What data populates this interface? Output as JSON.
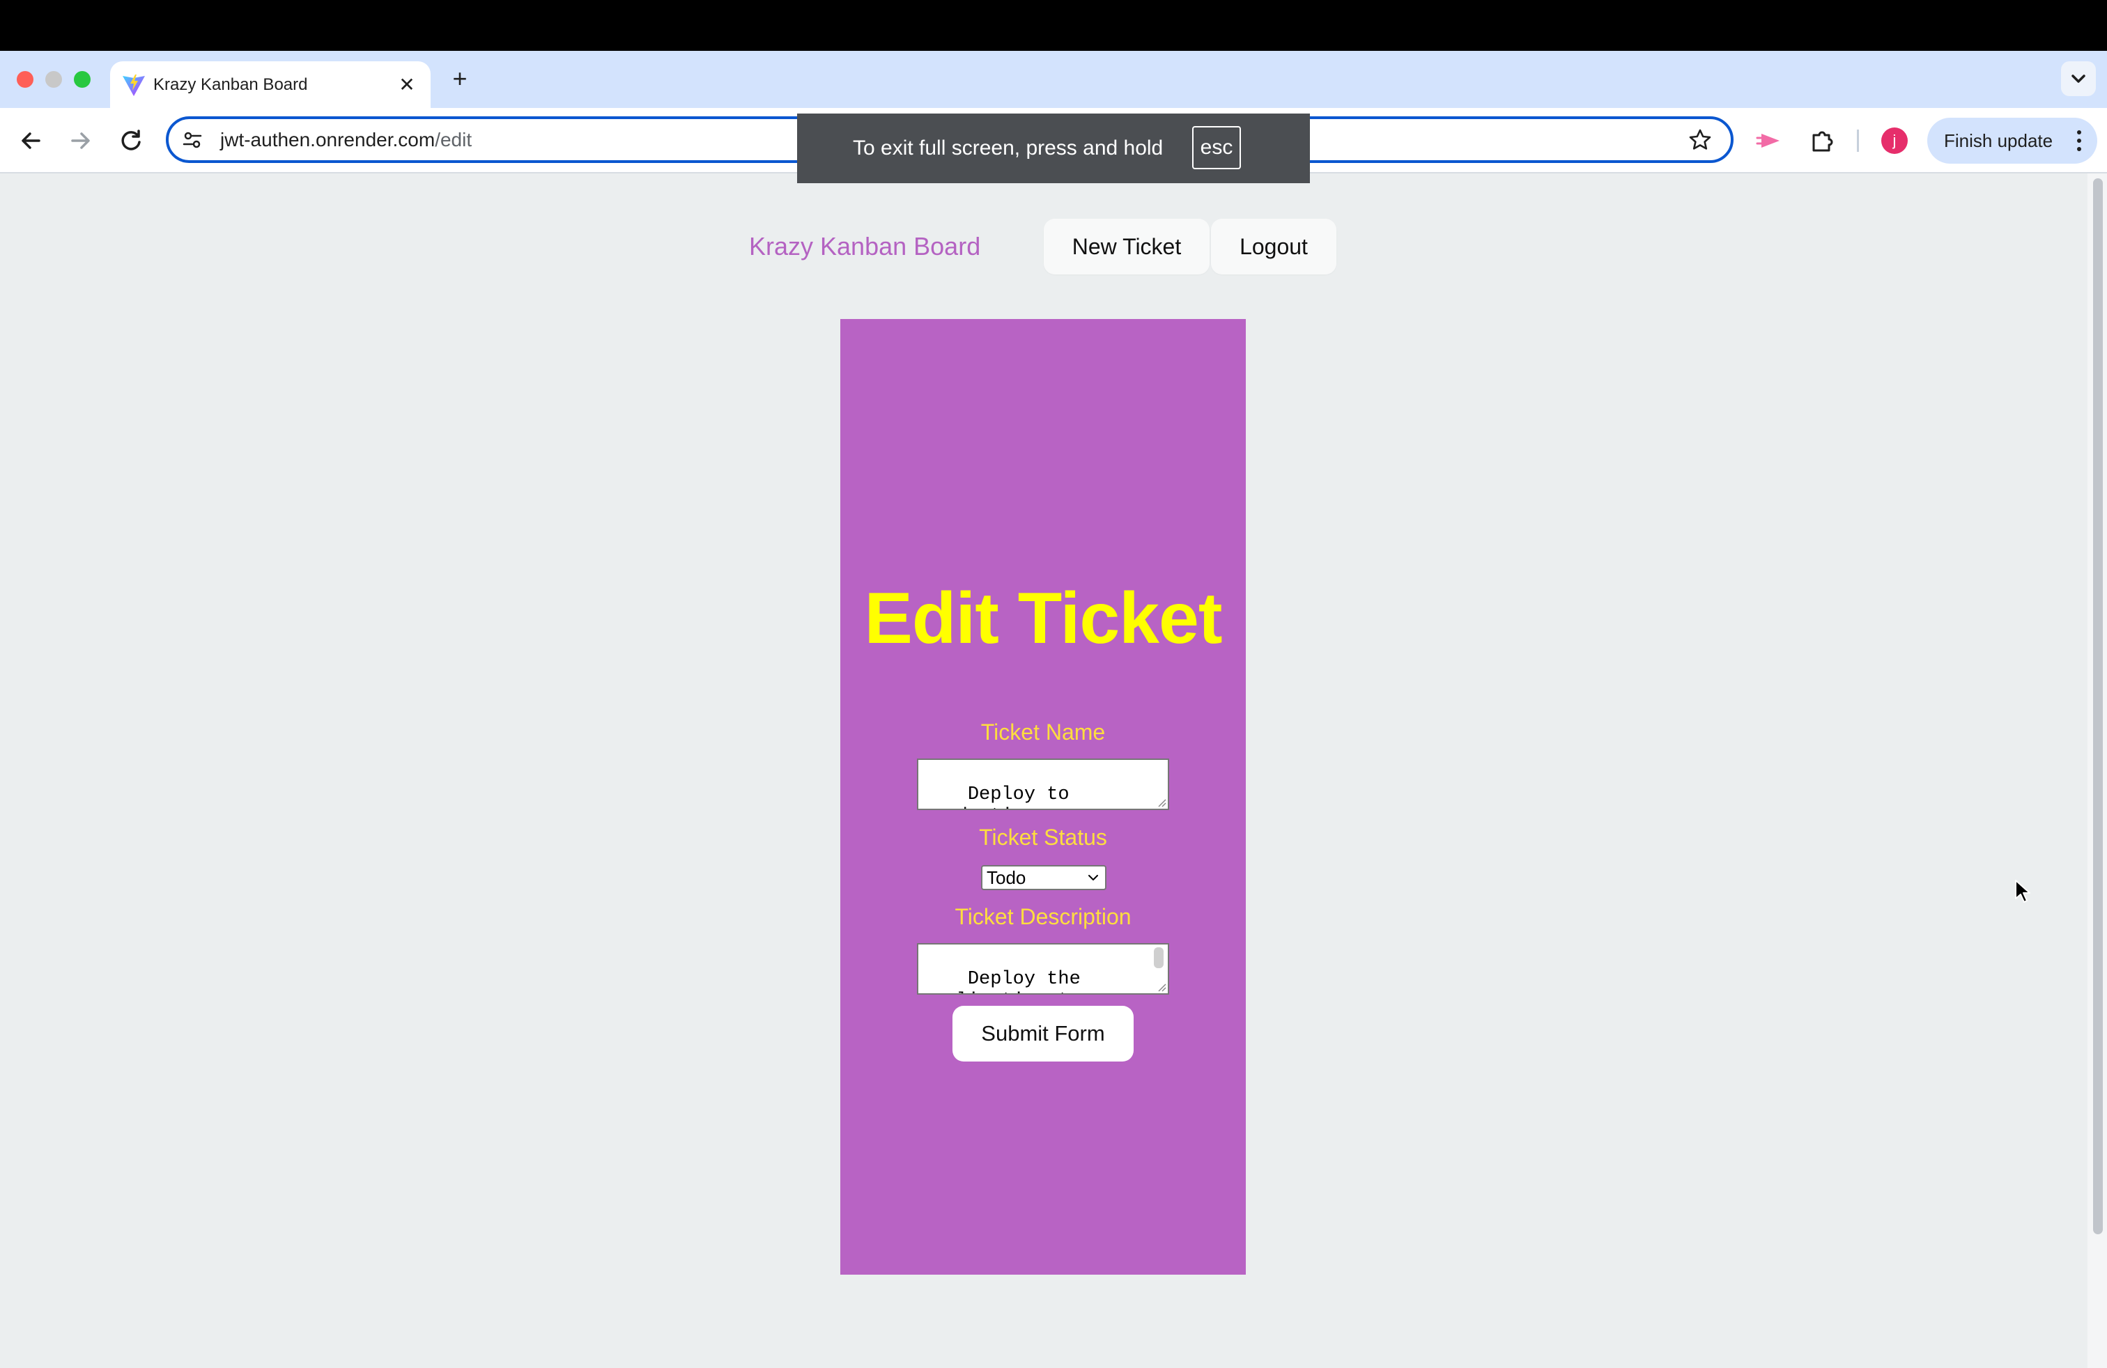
{
  "browser": {
    "tab_title": "Krazy Kanban Board",
    "url_host": "jwt-authen.onrender.com",
    "url_path": "/edit",
    "fullscreen_notice": "To exit full screen, press and hold",
    "fullscreen_key": "esc",
    "profile_initial": "j",
    "finish_update_label": "Finish update"
  },
  "header": {
    "brand": "Krazy Kanban Board",
    "new_ticket_label": "New Ticket",
    "logout_label": "Logout"
  },
  "form": {
    "heading": "Edit Ticket",
    "name_label": "Ticket Name",
    "name_value": "Deploy to production",
    "status_label": "Ticket Status",
    "status_value": "Todo",
    "description_label": "Ticket Description",
    "description_value": "Deploy the\napplication to",
    "submit_label": "Submit Form"
  },
  "colors": {
    "brand": "#b462c2",
    "card": "#b863c4",
    "heading": "#ffff00",
    "label": "#ffde3e",
    "page_bg": "#ebeeef"
  }
}
